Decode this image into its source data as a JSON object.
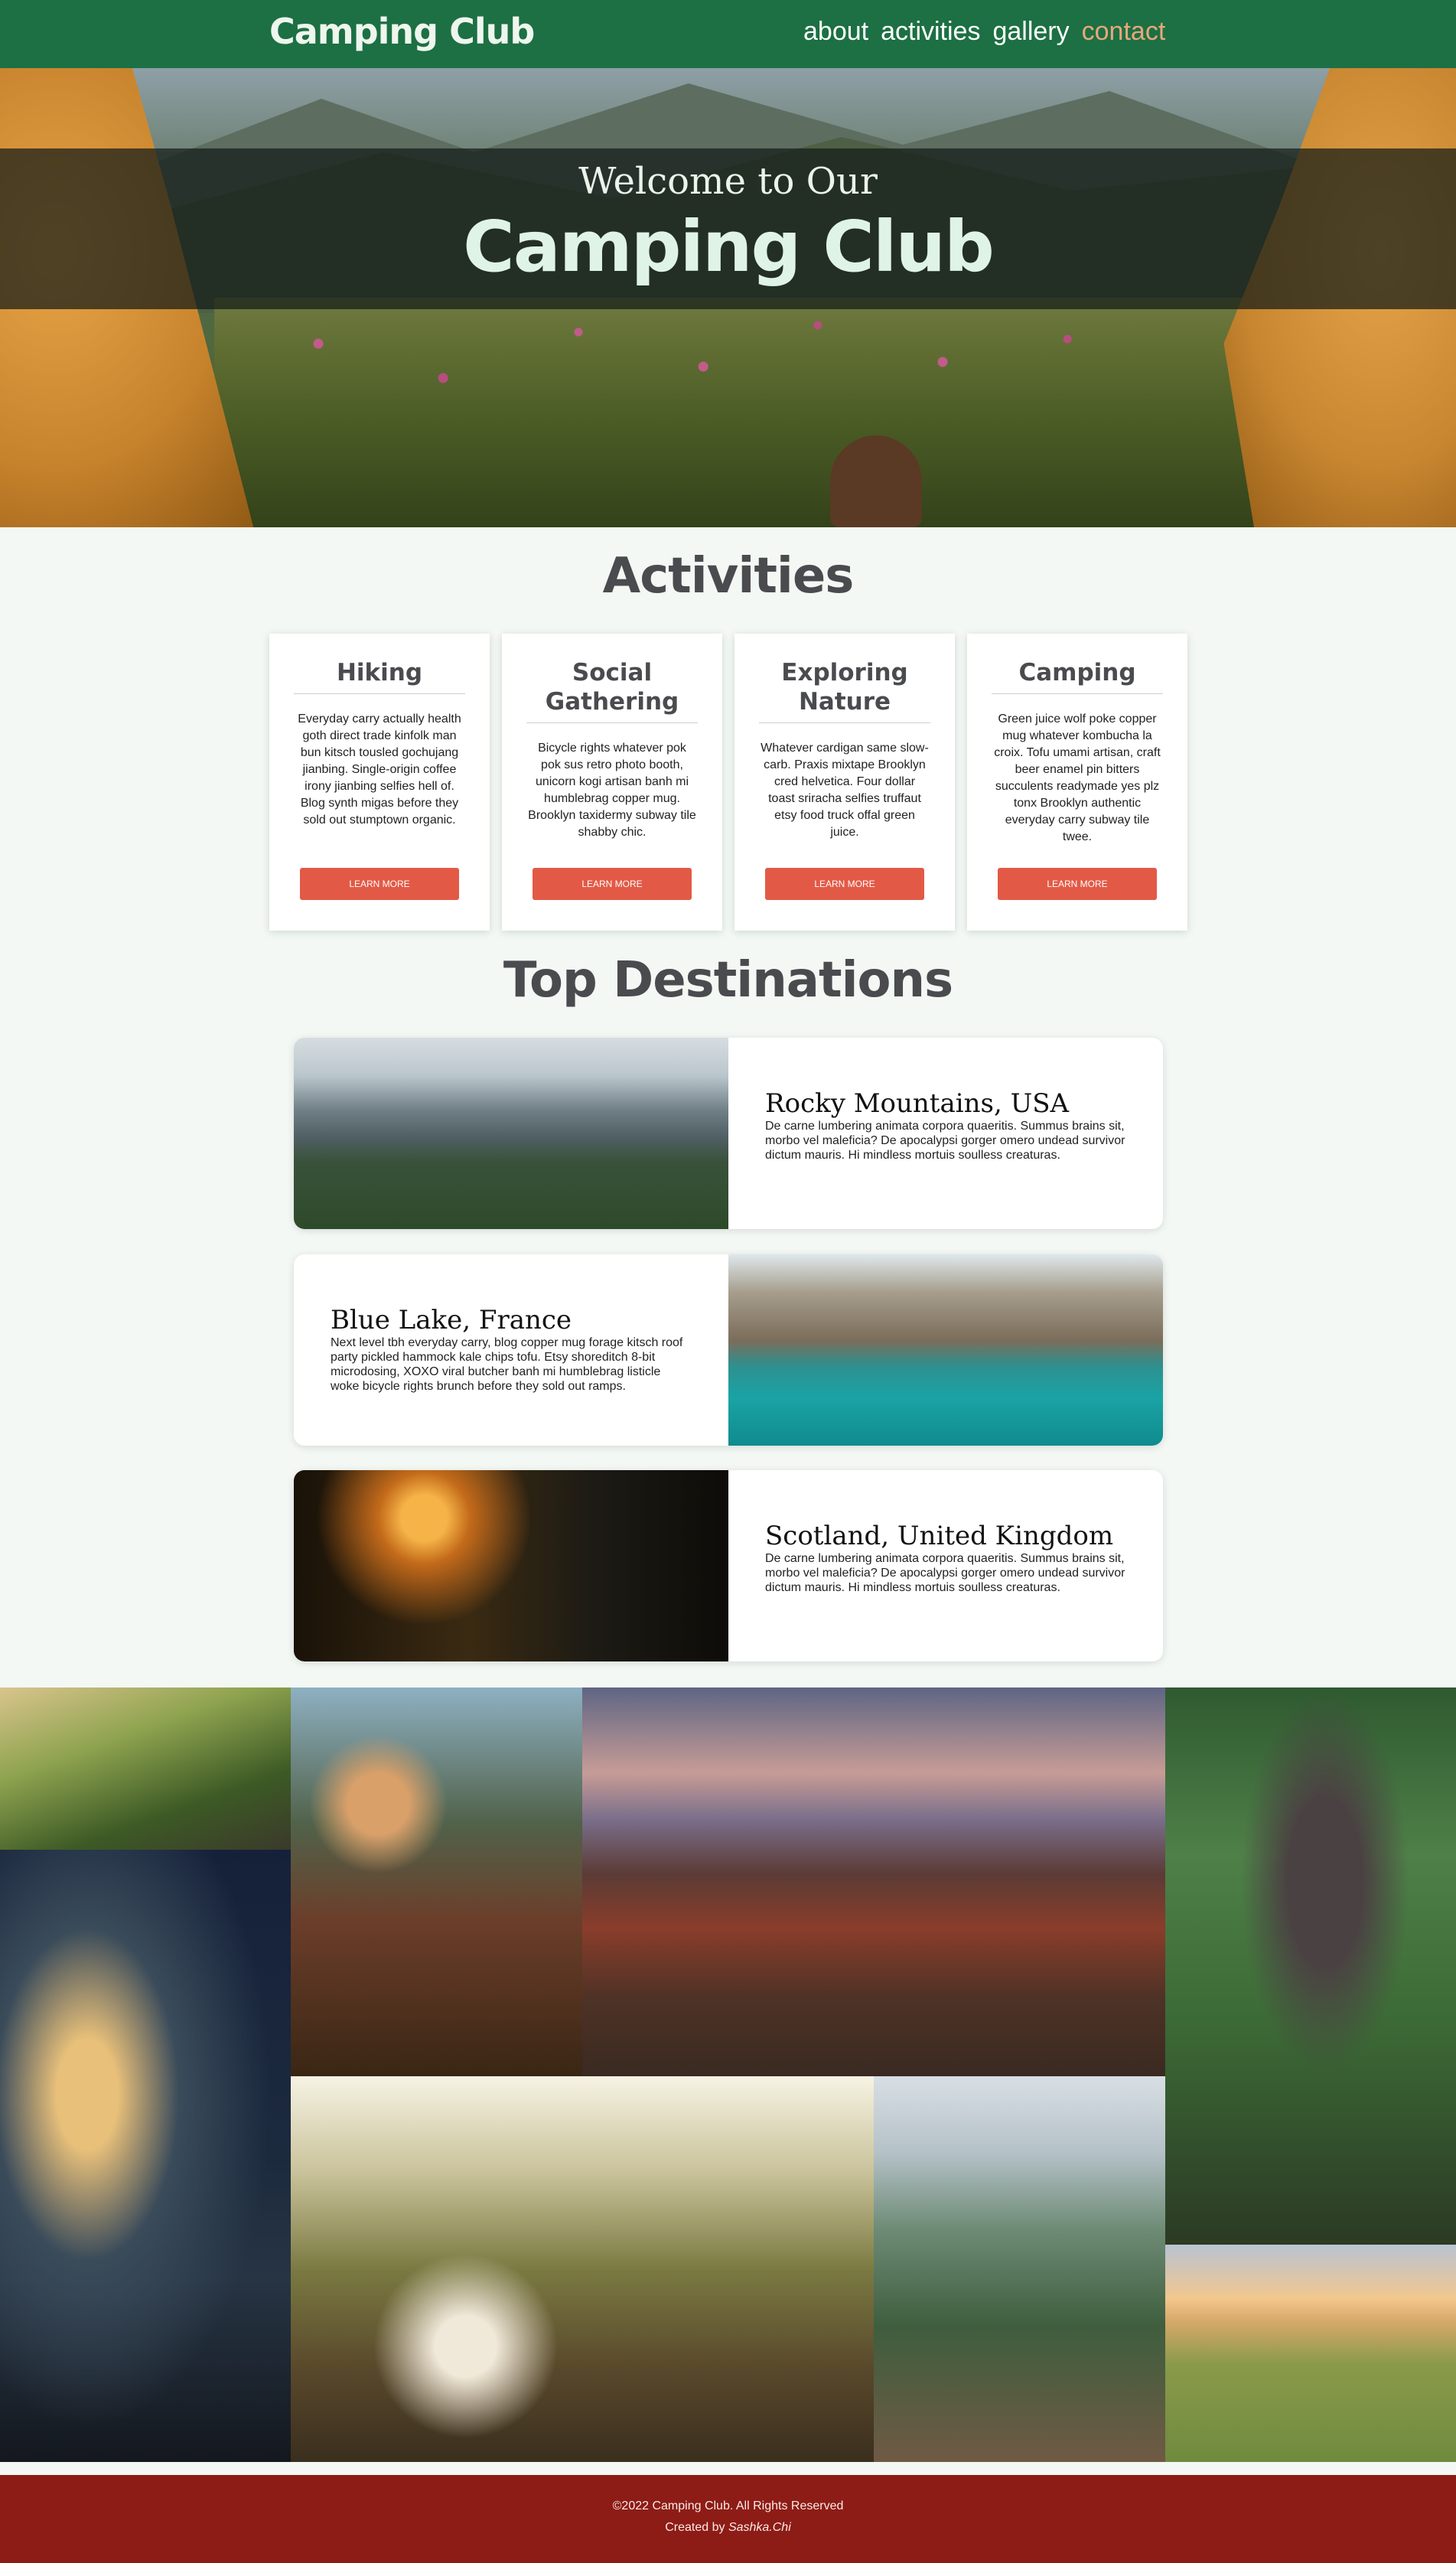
{
  "nav": {
    "brand": "Camping Club",
    "links": [
      "about",
      "activities",
      "gallery",
      "contact"
    ],
    "accent_color": "#e8a77c",
    "background": "#1c7043"
  },
  "hero": {
    "welcome": "Welcome to Our",
    "title": "Camping Club"
  },
  "activities": {
    "heading": "Activities",
    "cards": [
      {
        "title": "Hiking",
        "text": "Everyday carry actually health goth direct trade kinfolk man bun kitsch tousled gochujang jianbing. Single-origin coffee irony jianbing selfies hell of. Blog synth migas before they sold out stumptown organic.",
        "button": "LEARN MORE"
      },
      {
        "title": "Social Gathering",
        "text": "Bicycle rights whatever pok pok sus retro photo booth, unicorn kogi artisan banh mi humblebrag copper mug. Brooklyn taxidermy subway tile shabby chic.",
        "button": "LEARN MORE"
      },
      {
        "title": "Exploring Nature",
        "text": "Whatever cardigan same slow-carb. Praxis mixtape Brooklyn cred helvetica. Four dollar toast sriracha selfies truffaut etsy food truck offal green juice.",
        "button": "LEARN MORE"
      },
      {
        "title": "Camping",
        "text": "Green juice wolf poke copper mug whatever kombucha la croix. Tofu umami artisan, craft beer enamel pin bitters succulents readymade yes plz tonx Brooklyn authentic everyday carry subway tile twee.",
        "button": "LEARN MORE"
      }
    ],
    "button_color": "#e25a46"
  },
  "destinations": {
    "heading": "Top Destinations",
    "items": [
      {
        "title": "Rocky Mountains, USA",
        "text": "De carne lumbering animata corpora quaeritis. Summus brains sit, morbo vel maleficia? De apocalypsi gorger omero undead survivor dictum mauris. Hi mindless mortuis soulless creaturas."
      },
      {
        "title": "Blue Lake, France",
        "text": "Next level tbh everyday carry, blog copper mug forage kitsch roof party pickled hammock kale chips tofu. Etsy shoreditch 8-bit microdosing, XOXO viral butcher banh mi humblebrag listicle woke bicycle rights brunch before they sold out ramps."
      },
      {
        "title": "Scotland, United Kingdom",
        "text": "De carne lumbering animata corpora quaeritis. Summus brains sit, morbo vel maleficia? De apocalypsi gorger omero undead survivor dictum mauris. Hi mindless mortuis soulless creaturas."
      }
    ]
  },
  "footer": {
    "copyright": "©2022 Camping Club. All Rights Reserved",
    "created_prefix": "Created by ",
    "author": "Sashka.Chi",
    "background": "#8d1c16"
  }
}
